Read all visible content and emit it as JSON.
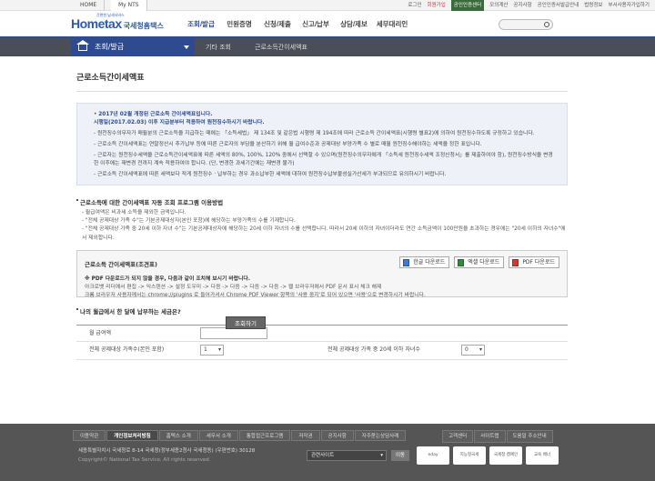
{
  "topbar": {
    "home_tab": "HOME",
    "mynts_tab": "My NTS",
    "links": [
      "로그인",
      "회원가입",
      "공인인증센터",
      "모의계산",
      "공지사항",
      "공인인증서발급안내",
      "법령정보",
      "부서사용자가입하기"
    ]
  },
  "header": {
    "logo_main": "Hometax",
    "logo_sub": "국세청홈택스",
    "logo_tagline": "간편한 납세서비스",
    "menu": [
      "조회/발급",
      "민원증명",
      "신청/제출",
      "신고/납부",
      "상담/제보",
      "세무대리인"
    ],
    "search_placeholder": ""
  },
  "lnb": {
    "current": "조회/발급",
    "crumb1": "기타 조회",
    "crumb2": "근로소득간이세액표"
  },
  "page": {
    "title": "근로소득간이세액표",
    "notice_lead": "2017년 02월 개정된 근로소득 간이세액표입니다.",
    "notice_date": "시행일(2017.02.03) 이후 지급분부터 적용하여 원천징수하시기 바랍니다.",
    "bullets": [
      "원천징수의무자가 매월분의 근로소득을 지급하는 때에는 「소득세법」 제 134조 및 같은법 시행령 제 194조에 따라 근로소득 간이세액표(시행령 별표2)에 의하여 원천징수하도록 규정하고 있습니다.",
      "근로소득 간이세액표는 연말정산시 추가납부 등에 따른 근로자의 부담을 분산하기 위해 월 급여수준과 공제대상 부양가족 수 별로 매월 원천징수해야하는 세액을 정한 표입니다.",
      "근로자는 원천징수세액을 근로소득간이세액표에 따른 세액의 80%, 100%, 120% 중에서 선택할 수 있으며(원천징수의무자에게 「소득세 원천징수세액 조정신청서」를 제출하여야 함), 원천징수방식을 변경한 이후에는 재변경 전까지 계속 적용하여야 합니다. (단, 변경한 과세기간에는 재변경 불가)",
      "근로소득 간이세액표에 따른 세액보다 적게 원천징수 · 납부하는 경우 과소납부한 세액에 대하여 원천징수납부불성실가산세가 부과되므로 유의하시기 바랍니다."
    ],
    "section1_title": "근로소득에 대한 간이세액표 자동 조회 프로그램 이용방법",
    "section1_items": [
      "- 월급여액은 비과세 소득을 제외한 금액입니다.",
      "- \"전체 공제대상 가족 수\"는 기본공제대상자(본인 포함)에 해당하는 부양가족의 수를 기재합니다.",
      "- \"전체 공제대상 가족 중 20세 이하 자녀 수\"는 기본공제대상자에 해당하는 20세 이하 자녀의 수를 선택합니다. 따라서 20세 이하의 자녀이더라도 연간 소득금액이 100만원을 초과하는 경우에는 \"20세 이하의 자녀수\"에서 제외합니다."
    ],
    "program_title": "근로소득 간이세액표(조견표)",
    "download_buttons": [
      "한글 다운로드",
      "엑셀 다운로드",
      "PDF 다운로드"
    ],
    "program_note1": "※ PDF 다운로드가 되지 않을 경우, 다음과 같이 조치해 보시기 바랍니다.",
    "program_note2": "아크로뱃 리더에서 편집 -> 익스텐션 -> 설정 도우미 -> 다음 -> 다음 -> 다음 -> 다음 -> 웹 브라우저에서 PDF 문서 표시 체크 해제",
    "program_note3": "크롬 브라우저 사용자께서는 chrome://plugins 로 들어가셔서 Chrome PDF Viewer 항목의 '사용 중지'로 되어 있으면 '사용'으로 변경하시기 바랍니다.",
    "section2_title": "나의 월급에서 한 달에 납부하는 세금은?",
    "monthly_label": "월 급여액",
    "monthly_value": "",
    "family_label": "전체 공제대상 가족수(본인 포함)",
    "family_value": "1",
    "children_label": "전체 공제대상 가족 중 20세 이하 자녀수",
    "children_value": "0",
    "calc_button": "조회하기"
  },
  "footer": {
    "nav": [
      "이용약관",
      "개인정보처리방침",
      "홈택스 소개",
      "세무서 소개",
      "통합접근프로그램",
      "저작권",
      "공지사항",
      "자주묻는상담사례"
    ],
    "nav_strong_index": 1,
    "right_nav": [
      "고객센터",
      "사이트맵",
      "도움말 주소안내"
    ],
    "address": "세종특별자치시 국세청로 8-14 국세청(정부세종2청사 국세청동) (우편번호) 30128",
    "copyright": "Copyright© National Tax Service. All rights reserved.",
    "related_site": "관련사이트",
    "go_button": "이동",
    "logos": [
      "eday",
      "지능형국세",
      "국세청 캠페인",
      "교육 배너"
    ]
  },
  "colors": {
    "brand": "#2e4b8f",
    "lnb_bg": "#4a4e56",
    "footer_bg": "#555555",
    "info_bg": "#eef2f8"
  }
}
